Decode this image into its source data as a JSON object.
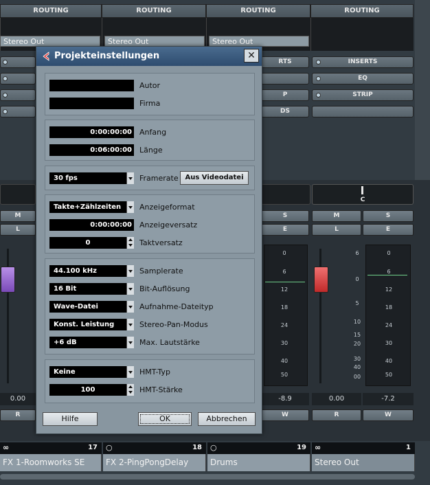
{
  "mixer": {
    "routing_label": "ROUTING",
    "stereo_out_label": "Stereo Out",
    "inserts_label": "INSERTS",
    "eq_label": "EQ",
    "strip_label": "STRIP",
    "inserts_partial": "RTS",
    "strip_partial": "P",
    "sends_partial": "DS",
    "pan_label": "C",
    "m_label": "M",
    "s_label": "S",
    "l_label": "L",
    "e_label": "E",
    "r_label": "R",
    "w_label": "W",
    "fader_values": [
      "0.00",
      "-8.9",
      "0.00",
      "-7.2"
    ],
    "scale_left": [
      "6",
      "0",
      "5",
      "10",
      "15",
      "20",
      "30",
      "40",
      "00"
    ],
    "scale_meter": [
      "0",
      "6",
      "12",
      "18",
      "24",
      "30",
      "40",
      "50"
    ],
    "channels": [
      {
        "name": "FX 1-Roomworks SE",
        "number": "17"
      },
      {
        "name": "FX 2-PingPongDelay",
        "number": "18"
      },
      {
        "name": "Drums",
        "number": "19"
      },
      {
        "name": "Stereo Out",
        "number": "1"
      }
    ]
  },
  "dialog": {
    "title": "Projekteinstellungen",
    "close": "✕",
    "autor_label": "Autor",
    "autor_value": "",
    "firma_label": "Firma",
    "firma_value": "",
    "anfang_label": "Anfang",
    "anfang_value": "0:00:00:00",
    "laenge_label": "Länge",
    "laenge_value": "0:06:00:00",
    "framerate_label": "Framerate",
    "framerate_value": "30 fps",
    "aus_videodatei": "Aus Videodatei",
    "anzeigeformat_label": "Anzeigeformat",
    "anzeigeformat_value": "Takte+Zählzeiten",
    "anzeigeversatz_label": "Anzeigeversatz",
    "anzeigeversatz_value": "0:00:00:00",
    "taktversatz_label": "Taktversatz",
    "taktversatz_value": "0",
    "samplerate_label": "Samplerate",
    "samplerate_value": "44.100 kHz",
    "bitaufloesung_label": "Bit-Auflösung",
    "bitaufloesung_value": "16 Bit",
    "aufnahme_label": "Aufnahme-Dateityp",
    "aufnahme_value": "Wave-Datei",
    "stereopan_label": "Stereo-Pan-Modus",
    "stereopan_value": "Konst. Leistung",
    "maxlaut_label": "Max. Lautstärke",
    "maxlaut_value": "+6 dB",
    "hmttyp_label": "HMT-Typ",
    "hmttyp_value": "Keine",
    "hmtstaerke_label": "HMT-Stärke",
    "hmtstaerke_value": "100",
    "hilfe": "Hilfe",
    "ok": "OK",
    "abbrechen": "Abbrechen"
  }
}
